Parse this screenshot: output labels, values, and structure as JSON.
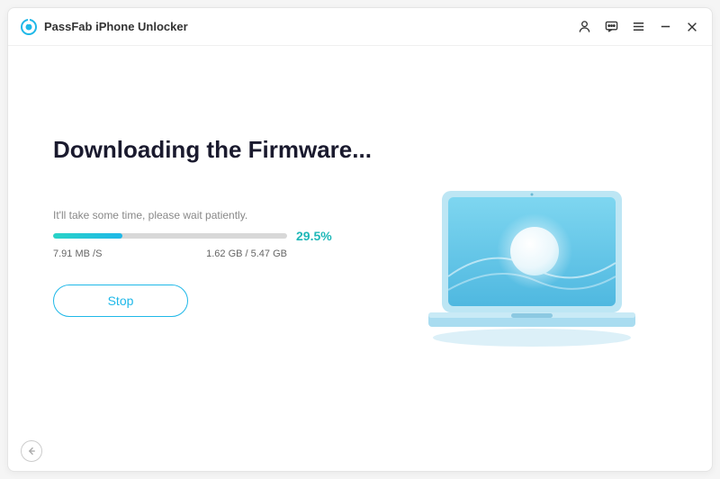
{
  "app": {
    "title": "PassFab iPhone Unlocker",
    "brand_color": "#1fb8e8"
  },
  "titlebar": {
    "icons": {
      "account": "account-icon",
      "feedback": "feedback-icon",
      "menu": "menu-icon",
      "minimize": "minimize-icon",
      "close": "close-icon"
    }
  },
  "main": {
    "heading": "Downloading the Firmware...",
    "wait_text": "It'll take some time, please wait patiently.",
    "progress": {
      "percent_label": "29.5%",
      "percent_value": 29.5,
      "speed": "7.91 MB /S",
      "size": "1.62 GB / 5.47 GB"
    },
    "stop_label": "Stop"
  },
  "footer": {
    "back_icon": "back-icon"
  }
}
